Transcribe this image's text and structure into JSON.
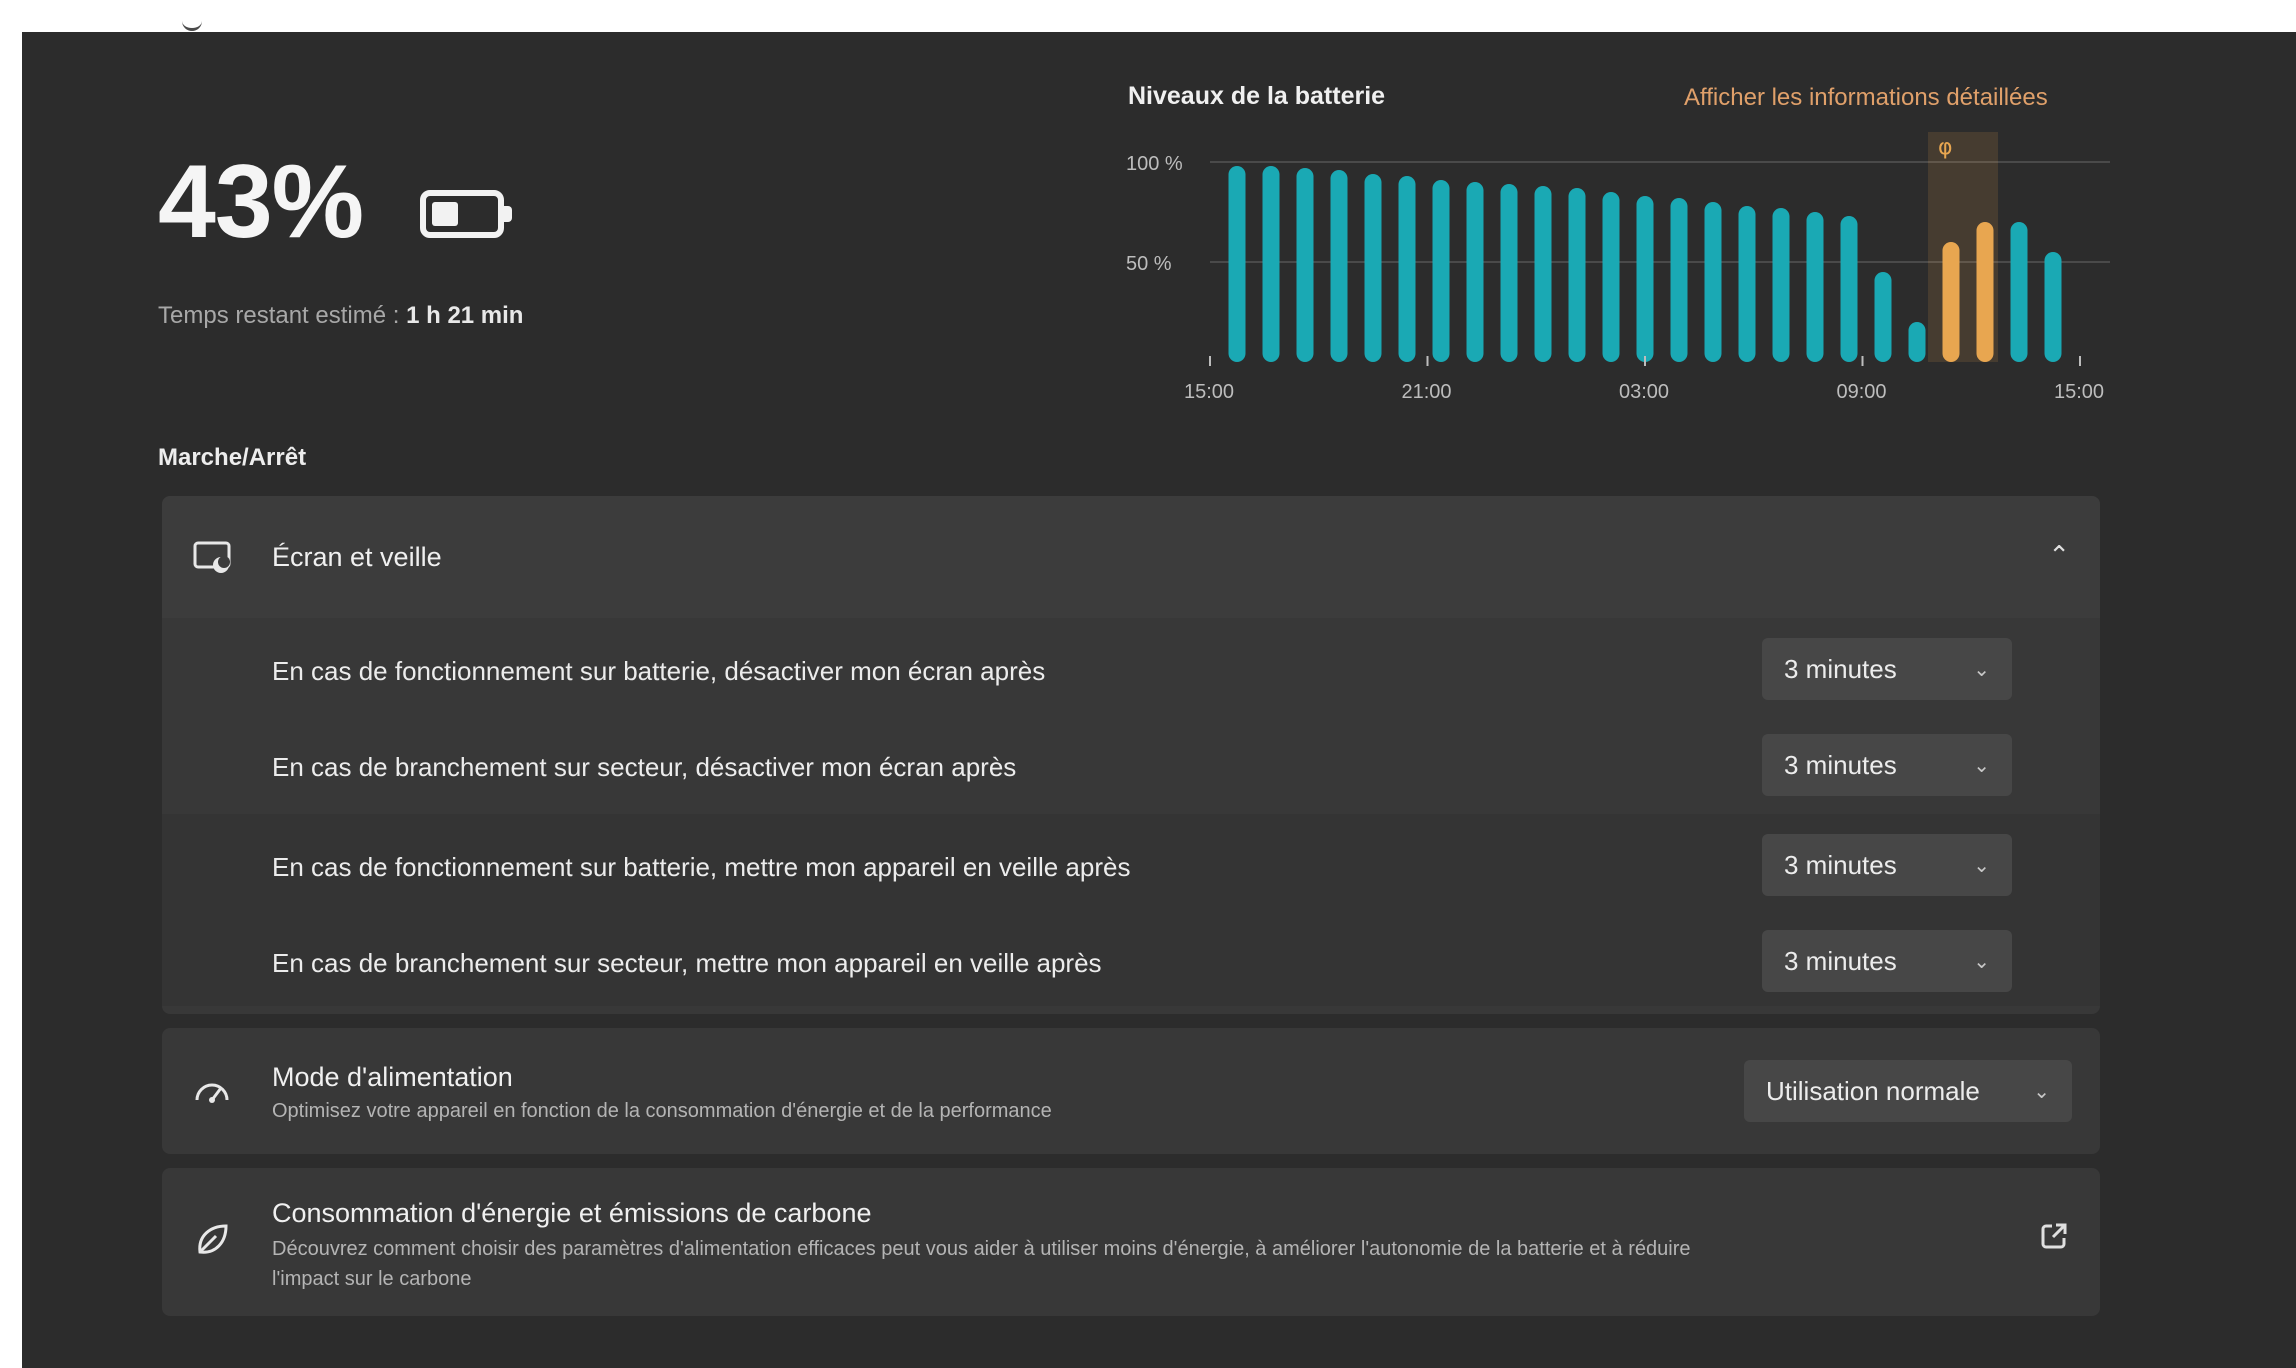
{
  "header": {
    "title_fragment": "consommation"
  },
  "battery": {
    "percent": "43%",
    "level": 0.43,
    "remaining_label": "Temps restant estimé : ",
    "remaining_value": "1 h 21 min"
  },
  "chart": {
    "title": "Niveaux de la batterie",
    "details_link": "Afficher les informations détaillées"
  },
  "chart_data": {
    "type": "bar",
    "title": "Niveaux de la batterie",
    "y_ticks": [
      "100 %",
      "50 %"
    ],
    "x_ticks": [
      "15:00",
      "21:00",
      "03:00",
      "09:00",
      "15:00"
    ],
    "ylim": [
      0,
      100
    ],
    "grid": true,
    "values": [
      98,
      98,
      97,
      96,
      94,
      93,
      91,
      90,
      89,
      88,
      87,
      85,
      83,
      82,
      80,
      78,
      77,
      75,
      73,
      45,
      20,
      60,
      70,
      70,
      55
    ],
    "series_colors": [
      "#1aa9b4",
      "#1aa9b4",
      "#1aa9b4",
      "#1aa9b4",
      "#1aa9b4",
      "#1aa9b4",
      "#1aa9b4",
      "#1aa9b4",
      "#1aa9b4",
      "#1aa9b4",
      "#1aa9b4",
      "#1aa9b4",
      "#1aa9b4",
      "#1aa9b4",
      "#1aa9b4",
      "#1aa9b4",
      "#1aa9b4",
      "#1aa9b4",
      "#1aa9b4",
      "#1aa9b4",
      "#1aa9b4",
      "#e8a650",
      "#e8a650",
      "#1aa9b4",
      "#1aa9b4"
    ],
    "bar_color": "#1aa9b4",
    "charging_color": "#e8a650"
  },
  "power": {
    "section_label": "Marche/Arrêt",
    "screen_sleep": {
      "title": "Écran et veille",
      "rows": [
        {
          "label": "En cas de fonctionnement sur batterie, désactiver mon écran après",
          "value": "3 minutes"
        },
        {
          "label": "En cas de branchement sur secteur, désactiver mon écran après",
          "value": "3 minutes"
        },
        {
          "label": "En cas de fonctionnement sur batterie, mettre mon appareil en veille après",
          "value": "3 minutes"
        },
        {
          "label": "En cas de branchement sur secteur, mettre mon appareil en veille après",
          "value": "3 minutes"
        }
      ]
    },
    "power_mode": {
      "title": "Mode d'alimentation",
      "subtitle": "Optimisez votre appareil en fonction de la consommation d'énergie et de la performance",
      "value": "Utilisation normale"
    },
    "carbon": {
      "title": "Consommation d'énergie et émissions de carbone",
      "subtitle_line1": "Découvrez comment choisir des paramètres d'alimentation efficaces peut vous aider à utiliser moins d'énergie, à améliorer l'autonomie de la batterie et à réduire",
      "subtitle_line2": "l'impact sur le carbone"
    }
  },
  "icons": {
    "screen_sleep": "monitor-moon-icon",
    "power_mode": "gauge-icon",
    "carbon": "leaf-icon",
    "external": "external-link-icon",
    "collapse": "chevron-up-icon",
    "dropdown": "chevron-down-icon"
  }
}
